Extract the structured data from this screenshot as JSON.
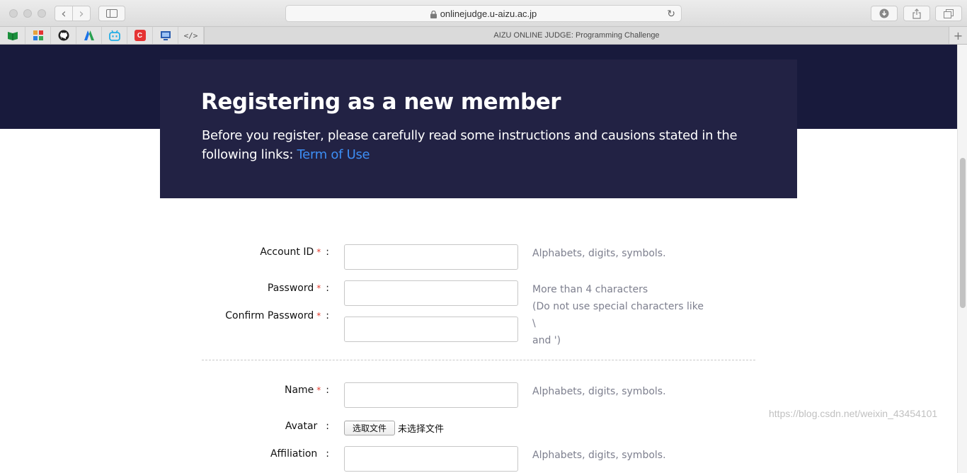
{
  "browser": {
    "url": "onlinejudge.u-aizu.ac.jp",
    "tab_title": "AIZU ONLINE JUDGE: Programming Challenge",
    "new_tab": "+",
    "back": "‹",
    "forward": "›"
  },
  "bookmarks": [
    {
      "icon": "book-icon",
      "color": "#1a8f3c"
    },
    {
      "icon": "grid-icon",
      "color": "#e9a23b"
    },
    {
      "icon": "github-icon",
      "color": "#222222"
    },
    {
      "icon": "azure-icon",
      "color": "#1a73e8"
    },
    {
      "icon": "bilibili-icon",
      "color": "#23ade5"
    },
    {
      "icon": "csdn-icon",
      "color": "#e53333"
    },
    {
      "icon": "monitor-icon",
      "color": "#2a5db0"
    },
    {
      "icon": "code-icon",
      "color": "#555555"
    }
  ],
  "hero": {
    "title": "Registering as a new member",
    "intro": "Before you register, please carefully read some instructions and causions stated in the following links:",
    "link": "Term of Use"
  },
  "form": {
    "account_id": {
      "label": "Account ID",
      "required": "*",
      "value": "",
      "hint": "Alphabets, digits, symbols."
    },
    "password": {
      "label": "Password",
      "required": "*",
      "value": "",
      "hint_lines": [
        "More than 4 characters",
        "(Do not use special characters like \\",
        "and ')"
      ]
    },
    "confirm_password": {
      "label": "Confirm Password",
      "required": "*",
      "value": ""
    },
    "name": {
      "label": "Name",
      "required": "*",
      "value": "",
      "hint": "Alphabets, digits, symbols."
    },
    "avatar": {
      "label": "Avatar",
      "button": "选取文件",
      "status": "未选择文件"
    },
    "affiliation": {
      "label": "Affiliation",
      "value": "",
      "hint": "Alphabets, digits, symbols."
    },
    "colon": ":"
  },
  "watermark": "https://blog.csdn.net/weixin_43454101",
  "colors": {
    "band": "#181a3c",
    "hero": "#222244",
    "link": "#3d8ef4",
    "required": "#e23c2e",
    "hint": "#7d7f8e"
  }
}
